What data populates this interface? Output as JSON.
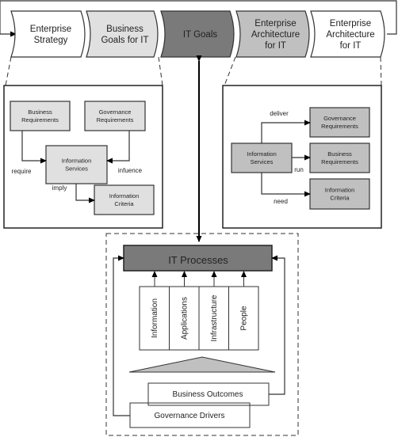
{
  "colors": {
    "light": "#e0e0e0",
    "mid": "#c0c0c0",
    "dark": "#7a7a7a",
    "white": "#ffffff"
  },
  "chevrons": [
    {
      "lines": [
        "Enterprise",
        "Strategy"
      ],
      "fill": "white"
    },
    {
      "lines": [
        "Business",
        "Goals for IT"
      ],
      "fill": "light"
    },
    {
      "lines": [
        "IT Goals"
      ],
      "fill": "dark"
    },
    {
      "lines": [
        "Enterprise",
        "Architecture",
        "for IT"
      ],
      "fill": "mid"
    },
    {
      "lines": [
        "Enterprise",
        "Architecture",
        "for IT"
      ],
      "fill": "white"
    }
  ],
  "left_panel": {
    "business_requirements": [
      "Business",
      "Requirements"
    ],
    "governance_requirements": [
      "Governance",
      "Requirements"
    ],
    "information_services": [
      "Information",
      "Services"
    ],
    "information_criteria": [
      "Information",
      "Criteria"
    ],
    "labels": {
      "require": "require",
      "influence": "infuence",
      "imply": "imply"
    }
  },
  "right_panel": {
    "information_services": [
      "Information",
      "Services"
    ],
    "governance_requirements": [
      "Governance",
      "Requirements"
    ],
    "business_requirements": [
      "Business",
      "Requirements"
    ],
    "information_criteria": [
      "Information",
      "Criteria"
    ],
    "labels": {
      "deliver": "deliver",
      "run": "run",
      "need": "need"
    }
  },
  "bottom": {
    "it_processes": "IT Processes",
    "resources": [
      "Information",
      "Applications",
      "Infrastructure",
      "People"
    ],
    "business_outcomes": "Business Outcomes",
    "governance_drivers": "Governance Drivers"
  }
}
